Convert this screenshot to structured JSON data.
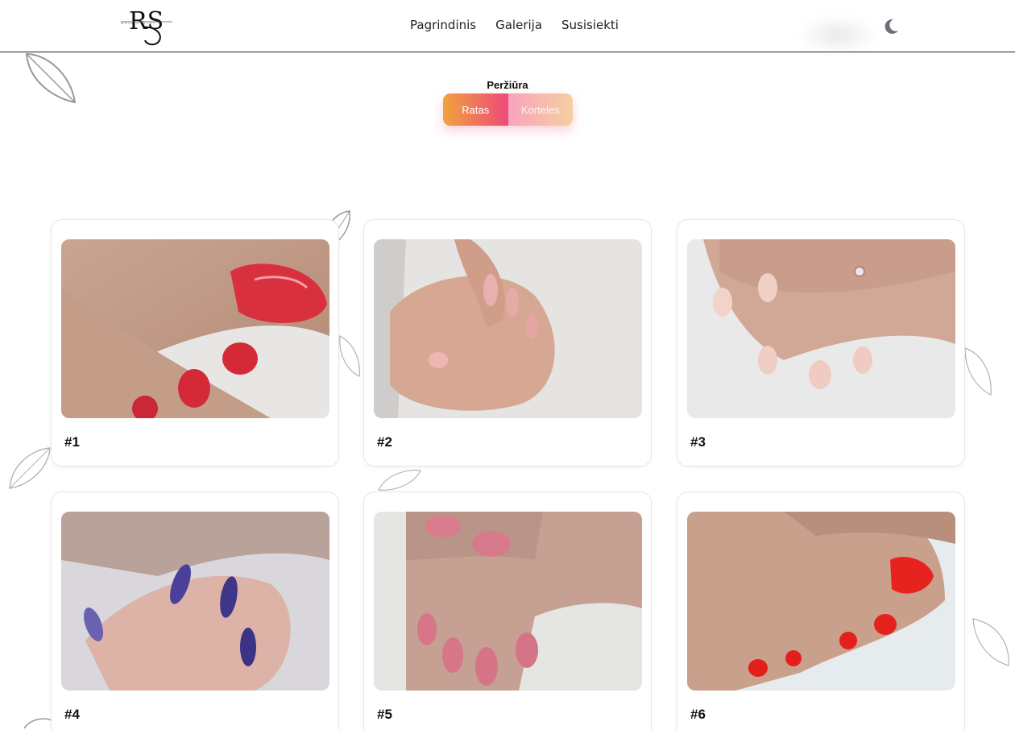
{
  "header": {
    "logo_text": "RS",
    "logo_subtext": "NAIL ARTIST",
    "nav": [
      "Pagrindinis",
      "Galerija",
      "Susisiekti"
    ]
  },
  "view_switch": {
    "label": "Peržiūra",
    "options": [
      "Ratas",
      "Korteles"
    ],
    "active": "Ratas"
  },
  "gallery": {
    "items": [
      {
        "caption": "#1",
        "image": "red-toenail-pedicure"
      },
      {
        "caption": "#2",
        "image": "pink-almond-manicure"
      },
      {
        "caption": "#3",
        "image": "nude-manicure-with-ring"
      },
      {
        "caption": "#4",
        "image": "purple-chrome-almond-nails"
      },
      {
        "caption": "#5",
        "image": "pink-manicure"
      },
      {
        "caption": "#6",
        "image": "bright-red-pedicure"
      }
    ]
  },
  "colors": {
    "accent_start": "#f0a33e",
    "accent_end": "#ee4a7a"
  }
}
